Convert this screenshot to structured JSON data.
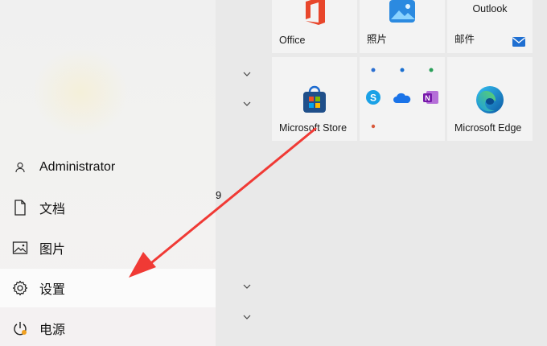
{
  "sidebar": {
    "items": [
      {
        "label": "Administrator",
        "icon": "person-icon"
      },
      {
        "label": "文档",
        "icon": "document-icon"
      },
      {
        "label": "图片",
        "icon": "pictures-icon"
      },
      {
        "label": "设置",
        "icon": "gear-icon"
      },
      {
        "label": "电源",
        "icon": "power-icon"
      }
    ],
    "selected": "设置"
  },
  "middle": {
    "fragment_text": "9"
  },
  "tiles": [
    {
      "label": "Office",
      "icon": "office-icon"
    },
    {
      "label": "照片",
      "icon": "photos-icon"
    },
    {
      "label": "邮件",
      "top_label": "Outlook",
      "icon": "mail-icon"
    },
    {
      "label": "Microsoft Store",
      "icon": "store-icon"
    },
    {
      "label": "",
      "icon": "folder-group"
    },
    {
      "label": "Microsoft Edge",
      "icon": "edge-icon"
    }
  ],
  "annotation": {
    "color": "#f03a35",
    "type": "arrow"
  }
}
